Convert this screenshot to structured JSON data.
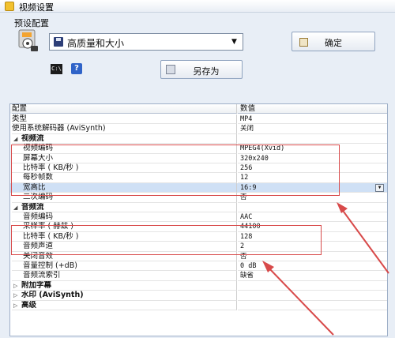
{
  "window": {
    "title": "视频设置"
  },
  "preset": {
    "label": "预设配置",
    "selected": "高质量和大小"
  },
  "buttons": {
    "ok": "确定",
    "save_as": "另存为"
  },
  "icons": {
    "cmd_text": "C:\\"
  },
  "grid": {
    "headers": {
      "name": "配置",
      "value": "数值"
    },
    "rows": [
      {
        "name": "类型",
        "value": "MP4"
      },
      {
        "name": "使用系统解码器 (AviSynth)",
        "value": "关闭"
      },
      {
        "name": "视频流",
        "value": ""
      },
      {
        "name": "视频编码",
        "value": "MPEG4(Xvid)"
      },
      {
        "name": "屏幕大小",
        "value": "320x240"
      },
      {
        "name": "比特率 ( KB/秒 )",
        "value": "256"
      },
      {
        "name": "每秒帧数",
        "value": "12"
      },
      {
        "name": "宽高比",
        "value": "16:9"
      },
      {
        "name": "二次编码",
        "value": "否"
      },
      {
        "name": "音频流",
        "value": ""
      },
      {
        "name": "音频编码",
        "value": "AAC"
      },
      {
        "name": "采样率 ( 赫兹 )",
        "value": "44100"
      },
      {
        "name": "比特率 ( KB/秒 )",
        "value": "128"
      },
      {
        "name": "音频声道",
        "value": "2"
      },
      {
        "name": "关闭音效",
        "value": "否"
      },
      {
        "name": "音量控制 (+dB)",
        "value": "0 dB"
      },
      {
        "name": "音频流索引",
        "value": "缺省"
      },
      {
        "name": "附加字幕",
        "value": ""
      },
      {
        "name": "水印 (AviSynth)",
        "value": ""
      },
      {
        "name": "高级",
        "value": ""
      }
    ]
  },
  "colors": {
    "annotation": "#d84a4a",
    "selection": "#cfe0f5"
  }
}
